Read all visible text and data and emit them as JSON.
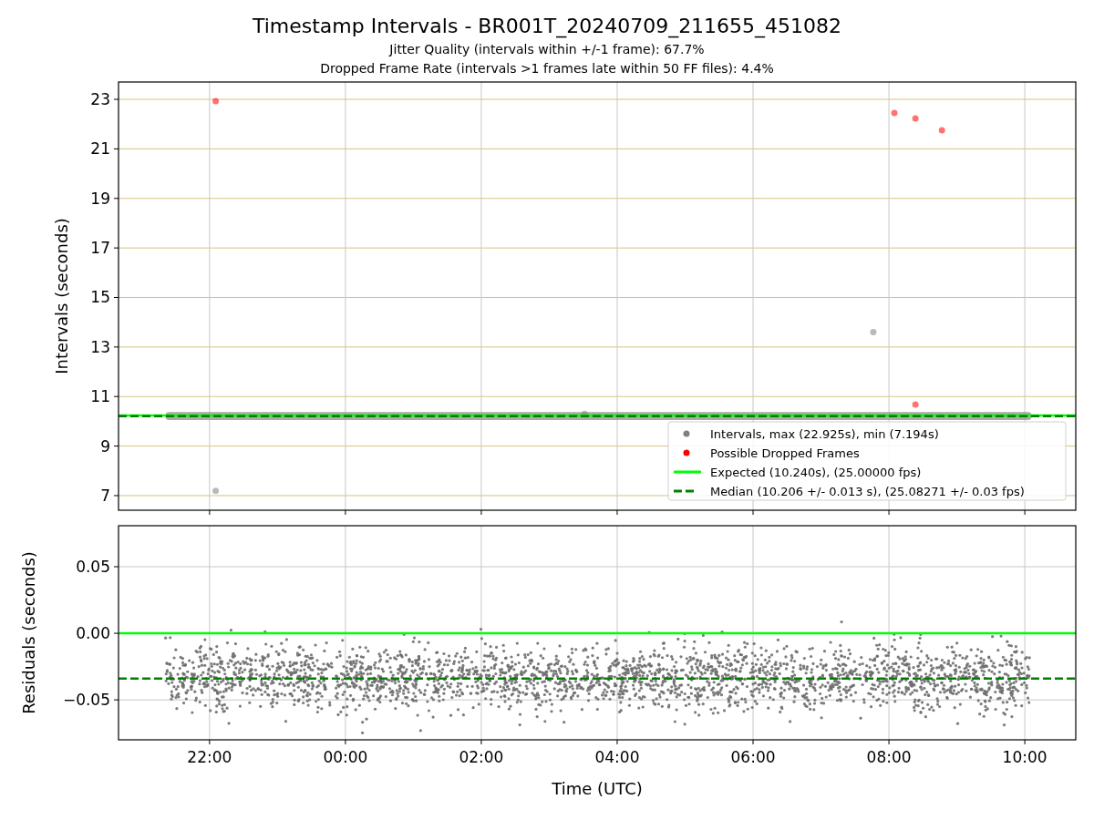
{
  "title": "Timestamp Intervals - BR001T_20240709_211655_451082",
  "subtitles": [
    "Jitter Quality (intervals within +/-1 frame): 67.7%",
    "Dropped Frame Rate (intervals >1 frames late within 50 FF files): 4.4%"
  ],
  "panels": [
    {
      "legend": [
        {
          "label": "Intervals, max (22.925s), min (7.194s)",
          "color": "#808080"
        },
        {
          "label": "Possible Dropped Frames",
          "color": "#ff0000"
        },
        {
          "label": "Expected (10.240s), (25.00000 fps)",
          "color": "#00ff00"
        },
        {
          "label": "Median (10.206 +/- 0.013 s), (25.08271 +/- 0.03 fps)",
          "color": "#008000"
        }
      ],
      "chart_data": {
        "type": "scatter",
        "ylabel": "Intervals (seconds)",
        "ylim": [
          6.41,
          23.7
        ],
        "grid": true,
        "categories": [
          null,
          null,
          null,
          null,
          null,
          null,
          null
        ],
        "yticks": [
          7,
          9,
          11,
          13,
          15,
          17,
          19,
          21,
          23
        ],
        "bands": [
          {
            "axis": "y",
            "from": 10.05,
            "to": 10.37,
            "color": "#9a9a9a"
          }
        ],
        "ref_lines": [
          {
            "axis": "y",
            "value": 10.24,
            "color": "#00ff00"
          },
          {
            "axis": "y",
            "value": 10.206,
            "color": "#008000"
          }
        ]
      }
    },
    {
      "chart_data": {
        "type": "scatter",
        "ylabel": "Residuals (seconds)",
        "xlabel": "Time (UTC)",
        "ylim": [
          -0.08,
          0.0808
        ],
        "grid": true,
        "categories": [
          "22:00",
          "00:00",
          "02:00",
          "04:00",
          "06:00",
          "08:00",
          "10:00"
        ],
        "yticks": [
          {
            "value": 0.05,
            "label": "0.05"
          },
          {
            "value": 0,
            "label": "0.00"
          },
          {
            "value": -0.05,
            "label": "−0.05"
          }
        ],
        "ref_lines": [
          {
            "axis": "y",
            "value": 0,
            "color": "#00ff00"
          },
          {
            "axis": "y",
            "value": -0.034,
            "color": "#008000"
          }
        ]
      }
    }
  ]
}
